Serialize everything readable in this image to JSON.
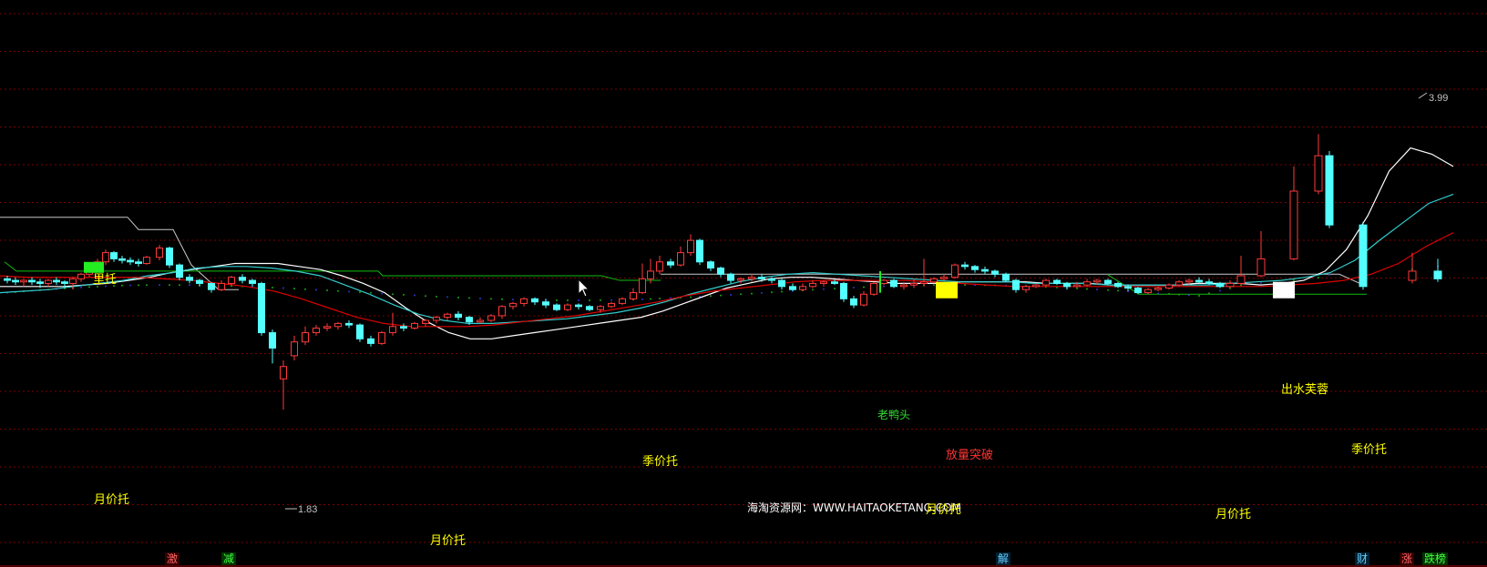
{
  "colors": {
    "background": "#000000",
    "grid": "#7a0000",
    "up_candle": "#ff3a3a",
    "down_candle": "#54ffff",
    "ma_white": "#ffffff",
    "ma_cyan": "#33cccc",
    "ma_red": "#dd0000",
    "support_white": "#c8c8c8",
    "support_green": "#11bb11",
    "label_yellow": "#ffff00",
    "label_red": "#ff3333"
  },
  "chart_data": {
    "type": "candlestick",
    "ylim": [
      1.55,
      4.3
    ],
    "grid": true,
    "candles": [
      [
        3.05,
        3.04,
        3.07,
        3.02
      ],
      [
        3.04,
        3.03,
        3.06,
        3.01
      ],
      [
        3.03,
        3.04,
        3.05,
        3.0
      ],
      [
        3.04,
        3.03,
        3.06,
        3.01
      ],
      [
        3.03,
        3.02,
        3.05,
        2.99
      ],
      [
        3.02,
        3.04,
        3.05,
        3.0
      ],
      [
        3.04,
        3.03,
        3.06,
        3.01
      ],
      [
        3.03,
        3.02,
        3.04,
        2.99
      ],
      [
        3.02,
        3.05,
        3.06,
        2.98
      ],
      [
        3.05,
        3.08,
        3.09,
        3.03
      ],
      [
        3.08,
        3.12,
        3.13,
        3.06
      ],
      [
        3.12,
        3.16,
        3.18,
        3.1
      ],
      [
        3.16,
        3.22,
        3.24,
        3.14
      ],
      [
        3.22,
        3.18,
        3.23,
        3.16
      ],
      [
        3.18,
        3.17,
        3.2,
        3.15
      ],
      [
        3.17,
        3.16,
        3.19,
        3.14
      ],
      [
        3.16,
        3.15,
        3.18,
        3.13
      ],
      [
        3.15,
        3.19,
        3.2,
        3.14
      ],
      [
        3.19,
        3.25,
        3.27,
        3.17
      ],
      [
        3.25,
        3.14,
        3.26,
        3.12
      ],
      [
        3.14,
        3.06,
        3.15,
        3.04
      ],
      [
        3.06,
        3.04,
        3.08,
        3.02
      ],
      [
        3.04,
        3.02,
        3.05,
        3.0
      ],
      [
        3.02,
        2.98,
        3.03,
        2.96
      ],
      [
        2.98,
        3.02,
        3.04,
        2.97
      ],
      [
        3.02,
        3.06,
        3.07,
        3.01
      ],
      [
        3.06,
        3.04,
        3.08,
        3.02
      ],
      [
        3.04,
        3.02,
        3.05,
        3.0
      ],
      [
        3.02,
        2.7,
        3.03,
        2.68
      ],
      [
        2.7,
        2.6,
        2.72,
        2.5
      ],
      [
        2.4,
        2.48,
        2.52,
        2.2
      ],
      [
        2.55,
        2.64,
        2.68,
        2.52
      ],
      [
        2.64,
        2.7,
        2.74,
        2.62
      ],
      [
        2.7,
        2.73,
        2.75,
        2.68
      ],
      [
        2.73,
        2.74,
        2.76,
        2.71
      ],
      [
        2.74,
        2.76,
        2.77,
        2.72
      ],
      [
        2.76,
        2.75,
        2.78,
        2.73
      ],
      [
        2.75,
        2.66,
        2.76,
        2.64
      ],
      [
        2.66,
        2.63,
        2.68,
        2.61
      ],
      [
        2.63,
        2.7,
        2.71,
        2.62
      ],
      [
        2.7,
        2.74,
        2.83,
        2.68
      ],
      [
        2.74,
        2.73,
        2.76,
        2.71
      ],
      [
        2.73,
        2.76,
        2.77,
        2.72
      ],
      [
        2.76,
        2.78,
        2.79,
        2.74
      ],
      [
        2.78,
        2.8,
        2.81,
        2.76
      ],
      [
        2.8,
        2.82,
        2.83,
        2.78
      ],
      [
        2.82,
        2.8,
        2.84,
        2.78
      ],
      [
        2.8,
        2.77,
        2.81,
        2.75
      ],
      [
        2.77,
        2.78,
        2.8,
        2.76
      ],
      [
        2.78,
        2.81,
        2.82,
        2.77
      ],
      [
        2.81,
        2.87,
        2.88,
        2.79
      ],
      [
        2.87,
        2.89,
        2.9,
        2.85
      ],
      [
        2.89,
        2.92,
        2.93,
        2.87
      ],
      [
        2.92,
        2.9,
        2.93,
        2.88
      ],
      [
        2.9,
        2.88,
        2.92,
        2.86
      ],
      [
        2.88,
        2.85,
        2.89,
        2.84
      ],
      [
        2.85,
        2.88,
        2.89,
        2.84
      ],
      [
        2.88,
        2.87,
        2.89,
        2.85
      ],
      [
        2.87,
        2.85,
        2.88,
        2.84
      ],
      [
        2.85,
        2.87,
        2.88,
        2.83
      ],
      [
        2.87,
        2.89,
        2.9,
        2.86
      ],
      [
        2.89,
        2.92,
        2.93,
        2.88
      ],
      [
        2.92,
        2.96,
        2.99,
        2.91
      ],
      [
        2.96,
        3.05,
        3.15,
        2.95
      ],
      [
        3.05,
        3.1,
        3.18,
        3.02
      ],
      [
        3.1,
        3.16,
        3.2,
        3.08
      ],
      [
        3.16,
        3.14,
        3.18,
        3.12
      ],
      [
        3.14,
        3.22,
        3.26,
        3.13
      ],
      [
        3.22,
        3.3,
        3.34,
        3.2
      ],
      [
        3.3,
        3.16,
        3.31,
        3.14
      ],
      [
        3.16,
        3.12,
        3.17,
        3.1
      ],
      [
        3.12,
        3.08,
        3.13,
        3.06
      ],
      [
        3.08,
        3.04,
        3.09,
        3.02
      ],
      [
        3.04,
        3.05,
        3.06,
        3.02
      ],
      [
        3.05,
        3.06,
        3.08,
        3.03
      ],
      [
        3.06,
        3.05,
        3.08,
        3.03
      ],
      [
        3.05,
        3.04,
        3.06,
        3.02
      ],
      [
        3.04,
        3.0,
        3.05,
        2.98
      ],
      [
        3.0,
        2.98,
        3.02,
        2.97
      ],
      [
        2.98,
        3.0,
        3.02,
        2.97
      ],
      [
        3.0,
        3.02,
        3.04,
        2.99
      ],
      [
        3.02,
        3.03,
        3.04,
        3.0
      ],
      [
        3.03,
        3.02,
        3.05,
        3.01
      ],
      [
        3.02,
        2.92,
        3.03,
        2.9
      ],
      [
        2.92,
        2.88,
        2.94,
        2.86
      ],
      [
        2.88,
        2.95,
        2.97,
        2.87
      ],
      [
        2.95,
        3.02,
        3.03,
        2.94
      ],
      [
        3.02,
        3.04,
        3.05,
        3.01
      ],
      [
        3.04,
        3.0,
        3.05,
        2.99
      ],
      [
        3.0,
        3.01,
        3.03,
        2.98
      ],
      [
        3.01,
        3.02,
        3.05,
        2.99
      ],
      [
        3.02,
        3.03,
        3.18,
        3.0
      ],
      [
        3.03,
        3.05,
        3.06,
        3.02
      ],
      [
        3.05,
        3.06,
        3.08,
        3.04
      ],
      [
        3.06,
        3.14,
        3.15,
        3.05
      ],
      [
        3.14,
        3.13,
        3.16,
        3.11
      ],
      [
        3.13,
        3.11,
        3.14,
        3.09
      ],
      [
        3.11,
        3.1,
        3.13,
        3.08
      ],
      [
        3.1,
        3.08,
        3.11,
        3.06
      ],
      [
        3.08,
        3.04,
        3.09,
        3.03
      ],
      [
        3.04,
        2.98,
        3.05,
        2.96
      ],
      [
        2.98,
        3.0,
        3.01,
        2.96
      ],
      [
        3.0,
        3.01,
        3.02,
        2.99
      ],
      [
        3.01,
        3.04,
        3.05,
        3.0
      ],
      [
        3.04,
        3.02,
        3.05,
        3.01
      ],
      [
        3.02,
        3.0,
        3.03,
        2.98
      ],
      [
        3.0,
        3.01,
        3.03,
        2.99
      ],
      [
        3.01,
        3.03,
        3.05,
        3.0
      ],
      [
        3.03,
        3.04,
        3.05,
        3.01
      ],
      [
        3.04,
        3.02,
        3.05,
        3.01
      ],
      [
        3.02,
        3.0,
        3.03,
        2.99
      ],
      [
        3.0,
        2.99,
        3.01,
        2.97
      ],
      [
        2.99,
        2.96,
        3.0,
        2.95
      ],
      [
        2.96,
        2.98,
        2.99,
        2.95
      ],
      [
        2.98,
        2.99,
        3.0,
        2.97
      ],
      [
        2.99,
        3.01,
        3.02,
        2.98
      ],
      [
        3.01,
        3.03,
        3.04,
        3.0
      ],
      [
        3.03,
        3.04,
        3.05,
        3.01
      ],
      [
        3.04,
        3.03,
        3.06,
        3.02
      ],
      [
        3.03,
        3.02,
        3.05,
        3.01
      ],
      [
        3.02,
        3.0,
        3.03,
        2.99
      ],
      [
        3.0,
        3.02,
        3.04,
        2.99
      ],
      [
        3.02,
        3.07,
        3.2,
        3.01
      ],
      [
        3.07,
        3.18,
        3.36,
        3.06
      ],
      [
        3.18,
        3.62,
        3.78,
        3.17
      ],
      [
        3.62,
        3.85,
        3.99,
        3.6
      ],
      [
        3.85,
        3.4,
        3.88,
        3.38
      ],
      [
        3.4,
        3.0,
        3.42,
        2.98
      ],
      [
        3.04,
        3.1,
        3.22,
        3.02
      ],
      [
        3.1,
        3.05,
        3.18,
        3.03
      ]
    ],
    "candle_x": [
      8,
      17,
      26,
      35,
      44,
      53,
      62,
      71,
      80,
      89,
      98,
      107,
      116,
      125,
      134,
      143,
      152,
      161,
      175,
      186,
      197,
      208,
      219,
      232,
      243,
      254,
      266,
      277,
      287,
      299,
      311,
      323,
      335,
      347,
      359,
      371,
      383,
      395,
      407,
      419,
      431,
      443,
      455,
      467,
      479,
      491,
      503,
      515,
      527,
      539,
      551,
      563,
      575,
      587,
      599,
      611,
      623,
      635,
      647,
      659,
      671,
      683,
      695,
      705,
      714,
      724,
      736,
      747,
      758,
      768,
      780,
      791,
      802,
      813,
      825,
      836,
      847,
      858,
      870,
      881,
      892,
      904,
      916,
      926,
      937,
      948,
      959,
      970,
      981,
      992,
      1003,
      1014,
      1025,
      1036,
      1048,
      1059,
      1070,
      1081,
      1092,
      1104,
      1115,
      1126,
      1137,
      1148,
      1160,
      1171,
      1182,
      1193,
      1204,
      1216,
      1227,
      1238,
      1249,
      1260,
      1271,
      1283,
      1294,
      1305,
      1316,
      1327,
      1339,
      1350,
      1362,
      1384,
      1420,
      1447,
      1459,
      1496,
      1550,
      1578
    ],
    "series": [
      {
        "values": [
          3.0,
          3.0,
          3.0,
          3.0,
          3.01,
          3.02,
          3.04,
          3.06,
          3.09,
          3.11,
          3.13,
          3.15,
          3.15,
          3.15,
          3.13,
          3.11,
          3.07,
          3.02,
          2.96,
          2.86,
          2.77,
          2.7,
          2.66,
          2.66,
          2.68,
          2.7,
          2.72,
          2.74,
          2.76,
          2.78,
          2.8,
          2.84,
          2.89,
          2.94,
          2.99,
          3.02,
          3.05,
          3.06,
          3.06,
          3.05,
          3.04,
          3.03,
          3.02,
          3.02,
          3.02,
          3.03,
          3.03,
          3.03,
          3.03,
          3.02,
          3.02,
          3.02,
          3.01,
          3.01,
          3.01,
          3.01,
          3.02,
          3.02,
          3.02,
          3.01,
          3.02,
          3.04,
          3.1,
          3.24,
          3.46,
          3.75,
          3.9,
          3.86,
          3.78
        ]
      },
      {
        "values": [
          2.96,
          2.97,
          2.98,
          3.0,
          3.02,
          3.04,
          3.07,
          3.09,
          3.12,
          3.13,
          3.13,
          3.12,
          3.1,
          3.07,
          3.01,
          2.95,
          2.88,
          2.82,
          2.78,
          2.76,
          2.76,
          2.77,
          2.78,
          2.79,
          2.81,
          2.83,
          2.86,
          2.9,
          2.95,
          2.99,
          3.03,
          3.06,
          3.08,
          3.09,
          3.08,
          3.07,
          3.06,
          3.05,
          3.04,
          3.03,
          3.03,
          3.03,
          3.02,
          3.02,
          3.02,
          3.01,
          3.01,
          3.01,
          3.01,
          3.01,
          3.02,
          3.03,
          3.04,
          3.06,
          3.09,
          3.17,
          3.3,
          3.42,
          3.54,
          3.6
        ]
      },
      {
        "values": [
          3.07,
          3.06,
          3.06,
          3.06,
          3.06,
          3.06,
          3.05,
          3.04,
          3.02,
          3.0,
          2.97,
          2.92,
          2.86,
          2.8,
          2.76,
          2.74,
          2.74,
          2.74,
          2.75,
          2.77,
          2.79,
          2.81,
          2.84,
          2.87,
          2.9,
          2.94,
          2.97,
          2.99,
          3.01,
          3.03,
          3.04,
          3.04,
          3.04,
          3.04,
          3.03,
          3.02,
          3.01,
          3.0,
          3.0,
          3.0,
          3.0,
          3.0,
          3.0,
          3.0,
          3.0,
          3.0,
          3.0,
          3.01,
          3.02,
          3.04,
          3.08,
          3.15,
          3.26,
          3.35
        ]
      }
    ],
    "annotations": {
      "high": "3.99",
      "low": "1.83"
    }
  },
  "labels": {
    "li_tuo": "里托",
    "yue_jia_tuo_1": "月价托",
    "yue_jia_tuo_2": "月价托",
    "ji_jia_tuo_1": "季价托",
    "fang_liang_tupo": "放量突破",
    "watermark": "海淘资源网：WWW.HAITAOKETANG.COM",
    "yue_jia_tuo_3": "月价托",
    "yue_jia_tuo_4": "月价托",
    "ji_jia_tuo_2": "季价托",
    "chu_shui_furong": "出水芙蓉",
    "lao_ya_tou": "老鸭头"
  },
  "badges": {
    "b1": "激",
    "b2": "减",
    "b3": "解",
    "b4": "财",
    "b5": "涨",
    "b6": "跌榜"
  }
}
